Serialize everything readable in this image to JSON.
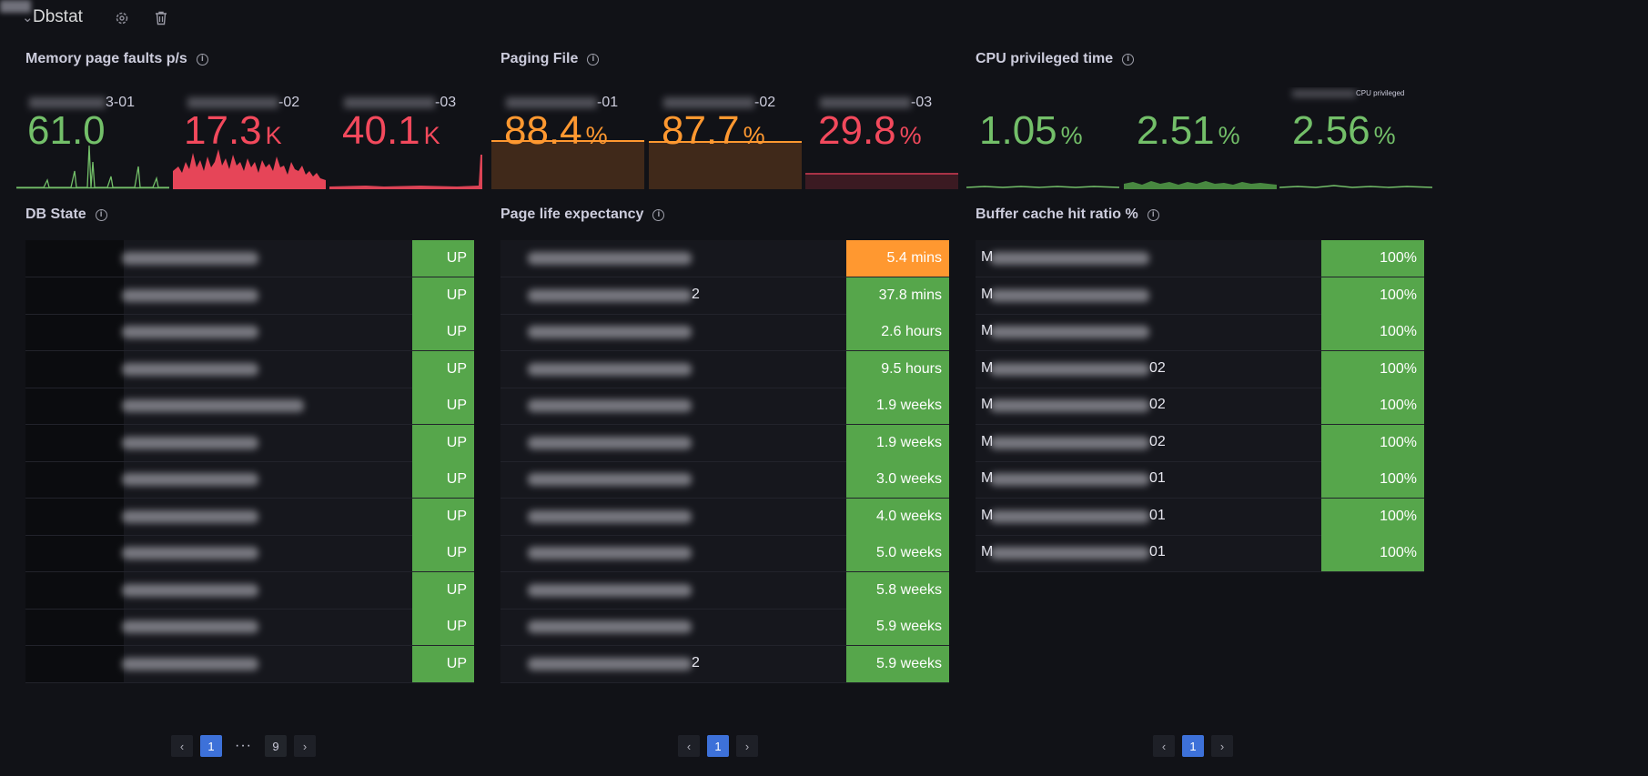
{
  "row": {
    "title": "Dbstat",
    "collapse_icon": "chevron-down-icon",
    "settings_icon": "gear-icon",
    "delete_icon": "trash-icon"
  },
  "colors": {
    "green": "#56a64b",
    "green_bright": "#73bf69",
    "red": "#f2495c",
    "orange": "#ff9830",
    "orange_fill": "#40291a",
    "red_fill": "#3b1a22",
    "bg": "#111217"
  },
  "panels": {
    "memory": {
      "title": "Memory page faults p/s",
      "stats": [
        {
          "name_suffix": "3-01",
          "value": "61.0",
          "unit": "",
          "color": "#73bf69"
        },
        {
          "name_suffix": "-02",
          "value": "17.3",
          "unit": "K",
          "color": "#f2495c"
        },
        {
          "name_suffix": "-03",
          "value": "40.1",
          "unit": "K",
          "color": "#f2495c"
        }
      ]
    },
    "paging": {
      "title": "Paging File",
      "stats": [
        {
          "name_suffix": "-01",
          "value": "88.4",
          "unit": "%",
          "color": "#ff9830",
          "fill": 0.884
        },
        {
          "name_suffix": "-02",
          "value": "87.7",
          "unit": "%",
          "color": "#ff9830",
          "fill": 0.877
        },
        {
          "name_suffix": "-03",
          "value": "29.8",
          "unit": "%",
          "color": "#f2495c",
          "fill": 0.298
        }
      ]
    },
    "cpu": {
      "title": "CPU privileged time",
      "stats": [
        {
          "name_suffix": "",
          "value": "1.05",
          "unit": "%",
          "color": "#73bf69"
        },
        {
          "name_suffix": "",
          "value": "2.51",
          "unit": "%",
          "color": "#73bf69"
        },
        {
          "name_suffix": "CPU privileged",
          "value": "2.56",
          "unit": "%",
          "color": "#73bf69"
        }
      ]
    },
    "db_state": {
      "title": "DB State",
      "rows": [
        "UP",
        "UP",
        "UP",
        "UP",
        "UP",
        "UP",
        "UP",
        "UP",
        "UP",
        "UP",
        "UP",
        "UP"
      ],
      "pager": {
        "current": "1",
        "last": "9",
        "ellipsis": "···",
        "prev_icon": "chevron-left-icon",
        "next_icon": "chevron-right-icon"
      }
    },
    "ple": {
      "title": "Page life expectancy",
      "rows": [
        {
          "value": "5.4 mins",
          "color": "#ff9830",
          "tail": ""
        },
        {
          "value": "37.8 mins",
          "color": "#56a64b",
          "tail": "2"
        },
        {
          "value": "2.6 hours",
          "color": "#56a64b",
          "tail": ""
        },
        {
          "value": "9.5 hours",
          "color": "#56a64b",
          "tail": ""
        },
        {
          "value": "1.9 weeks",
          "color": "#56a64b",
          "tail": ""
        },
        {
          "value": "1.9 weeks",
          "color": "#56a64b",
          "tail": ""
        },
        {
          "value": "3.0 weeks",
          "color": "#56a64b",
          "tail": ""
        },
        {
          "value": "4.0 weeks",
          "color": "#56a64b",
          "tail": ""
        },
        {
          "value": "5.0 weeks",
          "color": "#56a64b",
          "tail": ""
        },
        {
          "value": "5.8 weeks",
          "color": "#56a64b",
          "tail": ""
        },
        {
          "value": "5.9 weeks",
          "color": "#56a64b",
          "tail": ""
        },
        {
          "value": "5.9 weeks",
          "color": "#56a64b",
          "tail": "2"
        }
      ],
      "pager": {
        "current": "1"
      }
    },
    "buffer": {
      "title": "Buffer cache hit ratio %",
      "rows": [
        {
          "prefix": "M",
          "suffix": "",
          "value": "100%"
        },
        {
          "prefix": "M",
          "suffix": "",
          "value": "100%"
        },
        {
          "prefix": "M",
          "suffix": "",
          "value": "100%"
        },
        {
          "prefix": "M",
          "suffix": "02",
          "value": "100%"
        },
        {
          "prefix": "M",
          "suffix": "02",
          "value": "100%"
        },
        {
          "prefix": "M",
          "suffix": "02",
          "value": "100%"
        },
        {
          "prefix": "M",
          "suffix": "01",
          "value": "100%"
        },
        {
          "prefix": "M",
          "suffix": "01",
          "value": "100%"
        },
        {
          "prefix": "M",
          "suffix": "01",
          "value": "100%"
        }
      ],
      "pager": {
        "current": "1"
      }
    }
  }
}
